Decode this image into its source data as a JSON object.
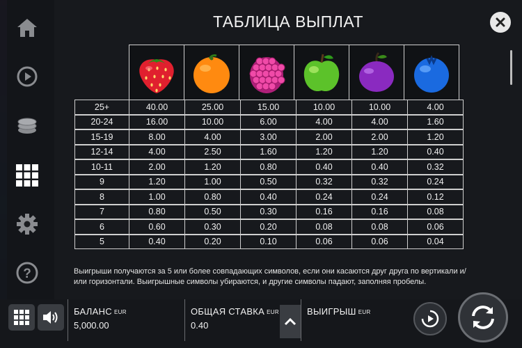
{
  "title": "ТАБЛИЦА ВЫПЛАТ",
  "sidebar": {
    "items": [
      {
        "name": "home-icon"
      },
      {
        "name": "autoplay-icon"
      },
      {
        "name": "coins-icon"
      },
      {
        "name": "paytable-grid-icon"
      },
      {
        "name": "settings-gear-icon"
      },
      {
        "name": "help-icon"
      }
    ]
  },
  "symbols": [
    {
      "name": "strawberry",
      "color": "#e0202e"
    },
    {
      "name": "orange",
      "color": "#ff8a10"
    },
    {
      "name": "raspberry",
      "color": "#e02a8a"
    },
    {
      "name": "apple",
      "color": "#5cc22a"
    },
    {
      "name": "plum",
      "color": "#8a2ac0"
    },
    {
      "name": "blueberry",
      "color": "#1a6ae0"
    }
  ],
  "paytable": {
    "rows": [
      {
        "count": "25+",
        "values": [
          "40.00",
          "25.00",
          "15.00",
          "10.00",
          "10.00",
          "4.00"
        ]
      },
      {
        "count": "20-24",
        "values": [
          "16.00",
          "10.00",
          "6.00",
          "4.00",
          "4.00",
          "1.60"
        ]
      },
      {
        "count": "15-19",
        "values": [
          "8.00",
          "4.00",
          "3.00",
          "2.00",
          "2.00",
          "1.20"
        ]
      },
      {
        "count": "12-14",
        "values": [
          "4.00",
          "2.50",
          "1.60",
          "1.20",
          "1.20",
          "0.40"
        ]
      },
      {
        "count": "10-11",
        "values": [
          "2.00",
          "1.20",
          "0.80",
          "0.40",
          "0.40",
          "0.32"
        ]
      },
      {
        "count": "9",
        "values": [
          "1.20",
          "1.00",
          "0.50",
          "0.32",
          "0.32",
          "0.24"
        ]
      },
      {
        "count": "8",
        "values": [
          "1.00",
          "0.80",
          "0.40",
          "0.24",
          "0.24",
          "0.12"
        ]
      },
      {
        "count": "7",
        "values": [
          "0.80",
          "0.50",
          "0.30",
          "0.16",
          "0.16",
          "0.08"
        ]
      },
      {
        "count": "6",
        "values": [
          "0.60",
          "0.30",
          "0.20",
          "0.08",
          "0.08",
          "0.06"
        ]
      },
      {
        "count": "5",
        "values": [
          "0.40",
          "0.20",
          "0.10",
          "0.06",
          "0.06",
          "0.04"
        ]
      }
    ]
  },
  "note": "Выигрыши получаются за 5 или более совпадающих символов, если они касаются друг друга по вертикали и/или горизонтали. Выигрышные символы убираются, и другие символы падают, заполняя пробелы.",
  "bottombar": {
    "balance_label": "БАЛАНС",
    "balance_currency": "EUR",
    "balance_value": "5,000.00",
    "bet_label": "ОБЩАЯ СТАВКА",
    "bet_currency": "EUR",
    "bet_value": "0.40",
    "win_label": "ВЫИГРЫШ",
    "win_currency": "EUR"
  }
}
